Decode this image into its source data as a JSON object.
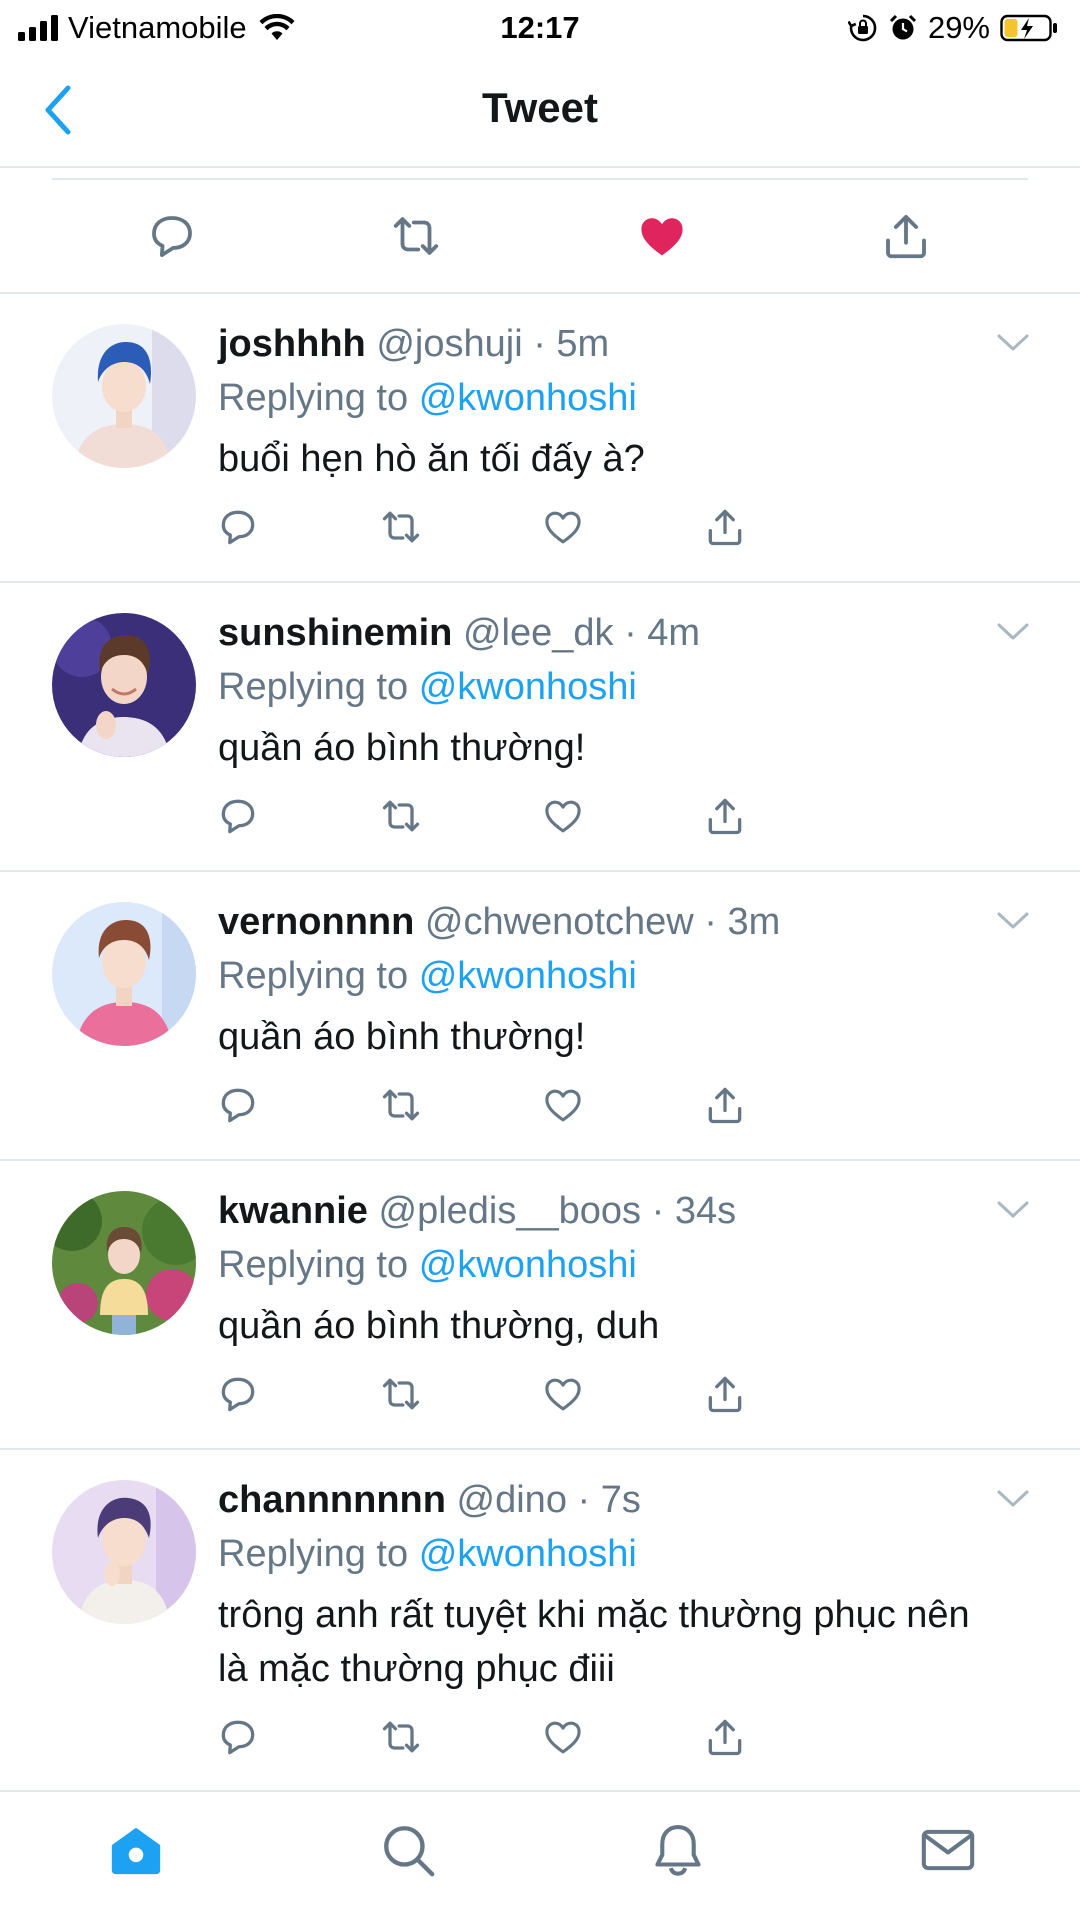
{
  "status_bar": {
    "carrier": "Vietnamobile",
    "time": "12:17",
    "battery": "29%"
  },
  "nav": {
    "title": "Tweet",
    "back_icon": "chevron-left-icon"
  },
  "main_actions": [
    {
      "icon": "reply-icon"
    },
    {
      "icon": "retweet-icon"
    },
    {
      "icon": "heart-filled-icon",
      "liked": true,
      "color": "#e0245e"
    },
    {
      "icon": "share-icon"
    }
  ],
  "replies": [
    {
      "name": "joshhhh",
      "handle": "@joshuji",
      "dot": "·",
      "time": "5m",
      "replying_prefix": "Replying to",
      "replying_to": "@kwonhoshi",
      "text": "buổi hẹn hò ăn tối đấy à?"
    },
    {
      "name": "sunshinemin",
      "handle": "@lee_dk",
      "dot": "·",
      "time": "4m",
      "replying_prefix": "Replying to",
      "replying_to": "@kwonhoshi",
      "text": "quần áo bình thường!"
    },
    {
      "name": "vernonnnn",
      "handle": "@chwenotchew",
      "dot": "·",
      "time": "3m",
      "replying_prefix": "Replying to",
      "replying_to": "@kwonhoshi",
      "text": "quần áo bình thường!"
    },
    {
      "name": "kwannie",
      "handle": "@pledis__boos",
      "dot": "·",
      "time": "34s",
      "replying_prefix": "Replying to",
      "replying_to": "@kwonhoshi",
      "text": "quần áo bình thường, duh"
    },
    {
      "name": "channnnnnn",
      "handle": "@dino",
      "dot": "·",
      "time": "7s",
      "replying_prefix": "Replying to",
      "replying_to": "@kwonhoshi",
      "text": "trông anh rất tuyệt khi mặc thường phục nên là mặc thường phục điii"
    }
  ],
  "tab_bar": [
    {
      "icon": "home-icon",
      "active": true
    },
    {
      "icon": "search-icon"
    },
    {
      "icon": "bell-icon"
    },
    {
      "icon": "mail-icon"
    }
  ],
  "colors": {
    "accent": "#1da1f2",
    "like": "#e0245e",
    "secondary_text": "#657786",
    "icon_gray": "#657786",
    "divider": "#e1e8ed"
  }
}
